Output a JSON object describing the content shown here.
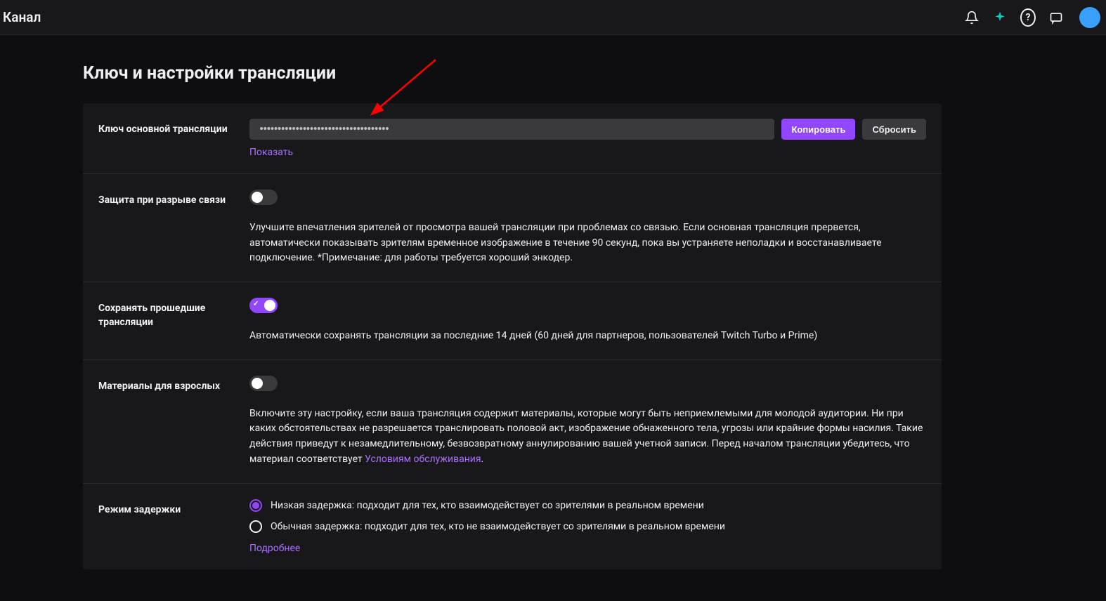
{
  "header": {
    "title": "Канал"
  },
  "page": {
    "title": "Ключ и настройки трансляции"
  },
  "streamKey": {
    "label": "Ключ основной трансляции",
    "masked": "••••••••••••••••••••••••••••••••••••",
    "copy": "Копировать",
    "reset": "Сбросить",
    "show": "Показать"
  },
  "disconnect": {
    "label": "Защита при разрыве связи",
    "enabled": false,
    "desc": "Улучшите впечатления зрителей от просмотра вашей трансляции при проблемах со связью. Если основная трансляция прервется, автоматически показывать зрителям временное изображение в течение 90 секунд, пока вы устраняете неполадки и восстанавливаете подключение. *Примечание: для работы требуется хороший энкодер."
  },
  "vods": {
    "label": "Сохранять прошедшие трансляции",
    "enabled": true,
    "desc": "Автоматически сохранять трансляции за последние 14 дней (60 дней для партнеров, пользователей Twitch Turbo и Prime)"
  },
  "mature": {
    "label": "Материалы для взрослых",
    "enabled": false,
    "desc_pre": "Включите эту настройку, если ваша трансляция содержит материалы, которые могут быть неприемлемыми для молодой аудитории. Ни при каких обстоятельствах не разрешается транслировать половой акт, изображение обнаженного тела, угрозы или крайние формы насилия. Такие действия приведут к незамедлительному, безвозвратному аннулированию вашей учетной записи. Перед началом трансляции убедитесь, что материал соответствует ",
    "desc_link": "Условиям обслуживания",
    "desc_post": "."
  },
  "latency": {
    "label": "Режим задержки",
    "low": "Низкая задержка: подходит для тех, кто взаимодействует со зрителями в реальном времени",
    "normal": "Обычная задержка: подходит для тех, кто не взаимодействует со зрителями в реальном времени",
    "selected": "low",
    "more": "Подробнее"
  }
}
